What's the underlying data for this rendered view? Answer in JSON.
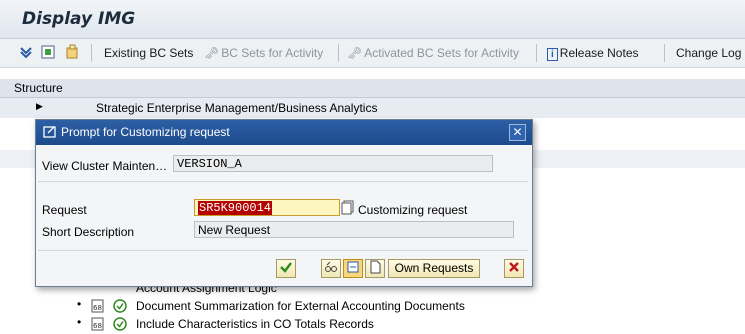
{
  "app": {
    "title": "Display IMG"
  },
  "toolbar": {
    "items": [
      {
        "label": "Existing BC Sets",
        "enabled": true
      },
      {
        "label": "BC Sets for Activity",
        "enabled": false
      },
      {
        "label": "Activated BC Sets for Activity",
        "enabled": false
      },
      {
        "label": "Release Notes",
        "enabled": true
      },
      {
        "label": "Change Log",
        "enabled": true
      }
    ]
  },
  "structure": {
    "header": "Structure",
    "rows": [
      {
        "label": "Strategic Enterprise Management/Business Analytics"
      },
      {
        "label": "Account Assignment Logic"
      },
      {
        "label": "Document Summarization for External Accounting Documents"
      },
      {
        "label": "Include Characteristics in CO Totals Records"
      }
    ]
  },
  "dialog": {
    "title": "Prompt for Customizing request",
    "view_cluster_label": "View Cluster Mainten…",
    "view_cluster_value": "VERSION_A",
    "request_label": "Request",
    "request_value": "SR5K900014",
    "customizing_request_label": "Customizing request",
    "short_description_label": "Short Description",
    "short_description_value": "New Request",
    "own_requests_label": "Own Requests"
  },
  "colors": {
    "dialog_title_bg": "#1d4a8c",
    "request_highlight": "#b40000",
    "confirm_green": "#2e8b1e",
    "cancel_red": "#c21a1a"
  }
}
